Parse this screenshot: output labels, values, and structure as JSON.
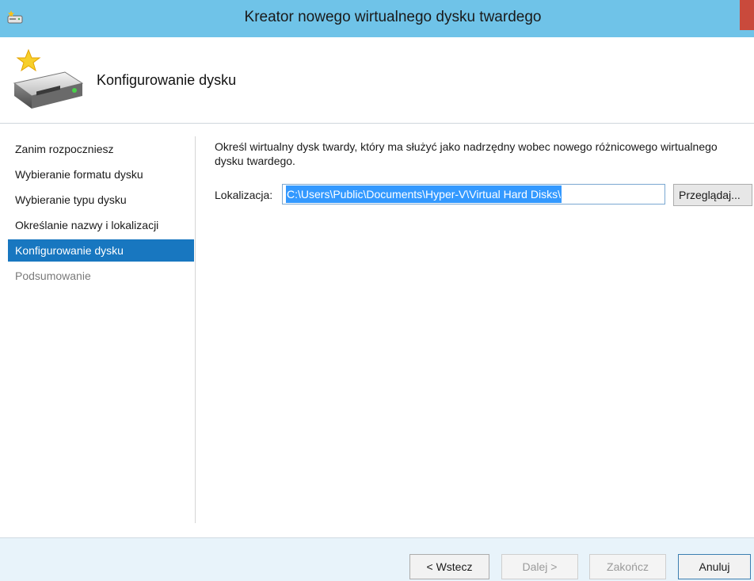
{
  "window": {
    "title": "Kreator nowego wirtualnego dysku twardego"
  },
  "header": {
    "title": "Konfigurowanie dysku"
  },
  "nav": {
    "items": [
      {
        "label": "Zanim rozpoczniesz"
      },
      {
        "label": "Wybieranie formatu dysku"
      },
      {
        "label": "Wybieranie typu dysku"
      },
      {
        "label": "Określanie nazwy i lokalizacji"
      },
      {
        "label": "Konfigurowanie dysku"
      },
      {
        "label": "Podsumowanie"
      }
    ]
  },
  "content": {
    "description": "Określ wirtualny dysk twardy, który ma służyć jako nadrzędny wobec nowego różnicowego wirtualnego dysku twardego.",
    "location_label": "Lokalizacja:",
    "location_value": "C:\\Users\\Public\\Documents\\Hyper-V\\Virtual Hard Disks\\",
    "browse_label": "Przeglądaj..."
  },
  "footer": {
    "back_label": "< Wstecz",
    "next_label": "Dalej >",
    "finish_label": "Zakończ",
    "cancel_label": "Anuluj"
  },
  "colors": {
    "titlebar": "#6fc3e8",
    "nav_active": "#1877c0",
    "selection": "#3399ff"
  }
}
